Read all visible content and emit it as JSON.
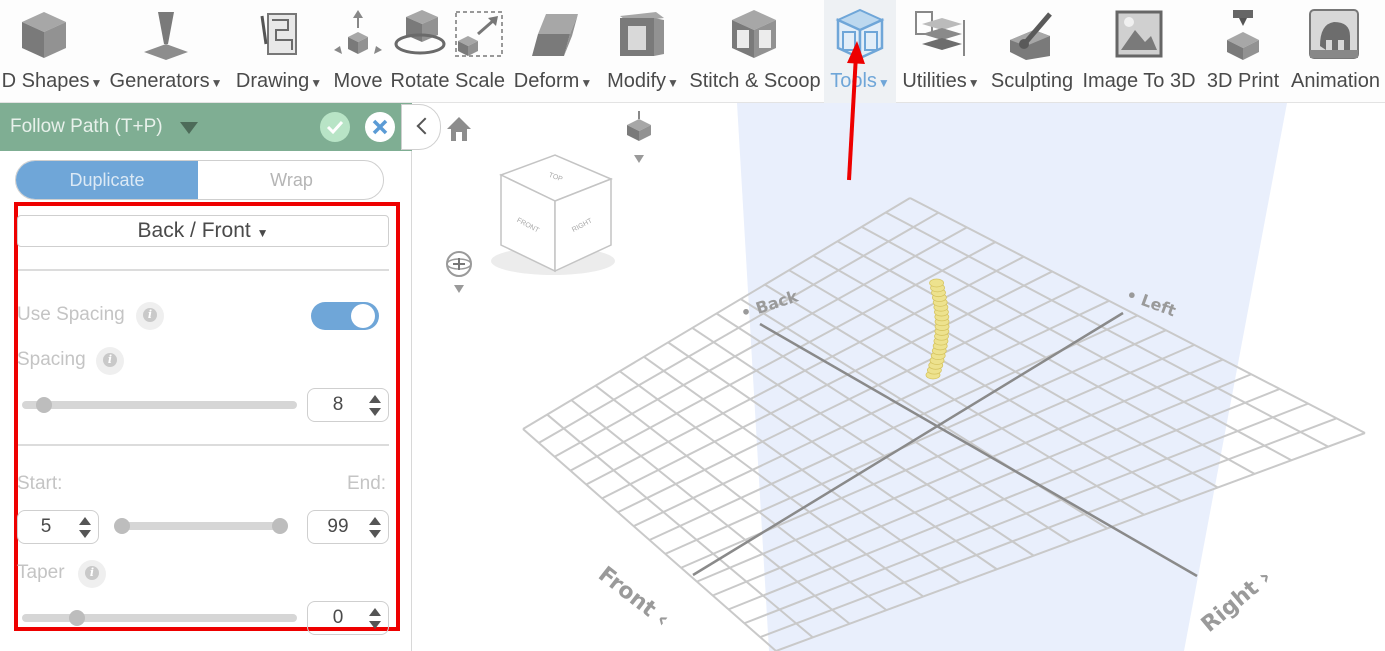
{
  "toolbar": {
    "items": [
      {
        "label": "D Shapes",
        "icon": "cube-icon",
        "dropdown": true
      },
      {
        "label": "Generators",
        "icon": "generator-icon",
        "dropdown": true
      },
      {
        "label": "Drawing",
        "icon": "drawing-icon",
        "dropdown": true
      },
      {
        "label": "Move",
        "icon": "move-icon",
        "dropdown": false
      },
      {
        "label": "Rotate",
        "icon": "rotate-icon",
        "dropdown": false
      },
      {
        "label": "Scale",
        "icon": "scale-icon",
        "dropdown": false
      },
      {
        "label": "Deform",
        "icon": "deform-icon",
        "dropdown": true
      },
      {
        "label": "Modify",
        "icon": "modify-icon",
        "dropdown": true
      },
      {
        "label": "Stitch & Scoop",
        "icon": "stitch-scoop-icon",
        "dropdown": false
      },
      {
        "label": "Tools",
        "icon": "tools-icon",
        "dropdown": true,
        "active": true
      },
      {
        "label": "Utilities",
        "icon": "utilities-icon",
        "dropdown": true
      },
      {
        "label": "Sculpting",
        "icon": "sculpting-icon",
        "dropdown": false
      },
      {
        "label": "Image To 3D",
        "icon": "image-to-3d-icon",
        "dropdown": false
      },
      {
        "label": "3D Print",
        "icon": "3d-print-icon",
        "dropdown": false
      },
      {
        "label": "Animation",
        "icon": "animation-icon",
        "dropdown": false
      }
    ]
  },
  "panel": {
    "title": "Follow Path (T+P)",
    "mode_tabs": [
      "Duplicate",
      "Wrap"
    ],
    "active_tab": "Duplicate",
    "direction": "Back / Front",
    "use_spacing_label": "Use Spacing",
    "use_spacing_on": true,
    "spacing_label": "Spacing",
    "spacing_value": "8",
    "spacing_fraction": 0.08,
    "start_label": "Start:",
    "end_label": "End:",
    "start_value": "5",
    "end_value": "99",
    "taper_label": "Taper",
    "taper_value": "0",
    "taper_fraction": 0.2
  },
  "viewcube": {
    "top": "TOP",
    "front": "FRONT",
    "right": "RIGHT"
  },
  "grid_labels": {
    "back": "Back",
    "left": "Left",
    "front": "Front",
    "right": "Right"
  },
  "colors": {
    "accent": "#6fa6d8",
    "panel_header": "#7fae93",
    "highlight": "#ee0000",
    "model": "#ede28e"
  }
}
